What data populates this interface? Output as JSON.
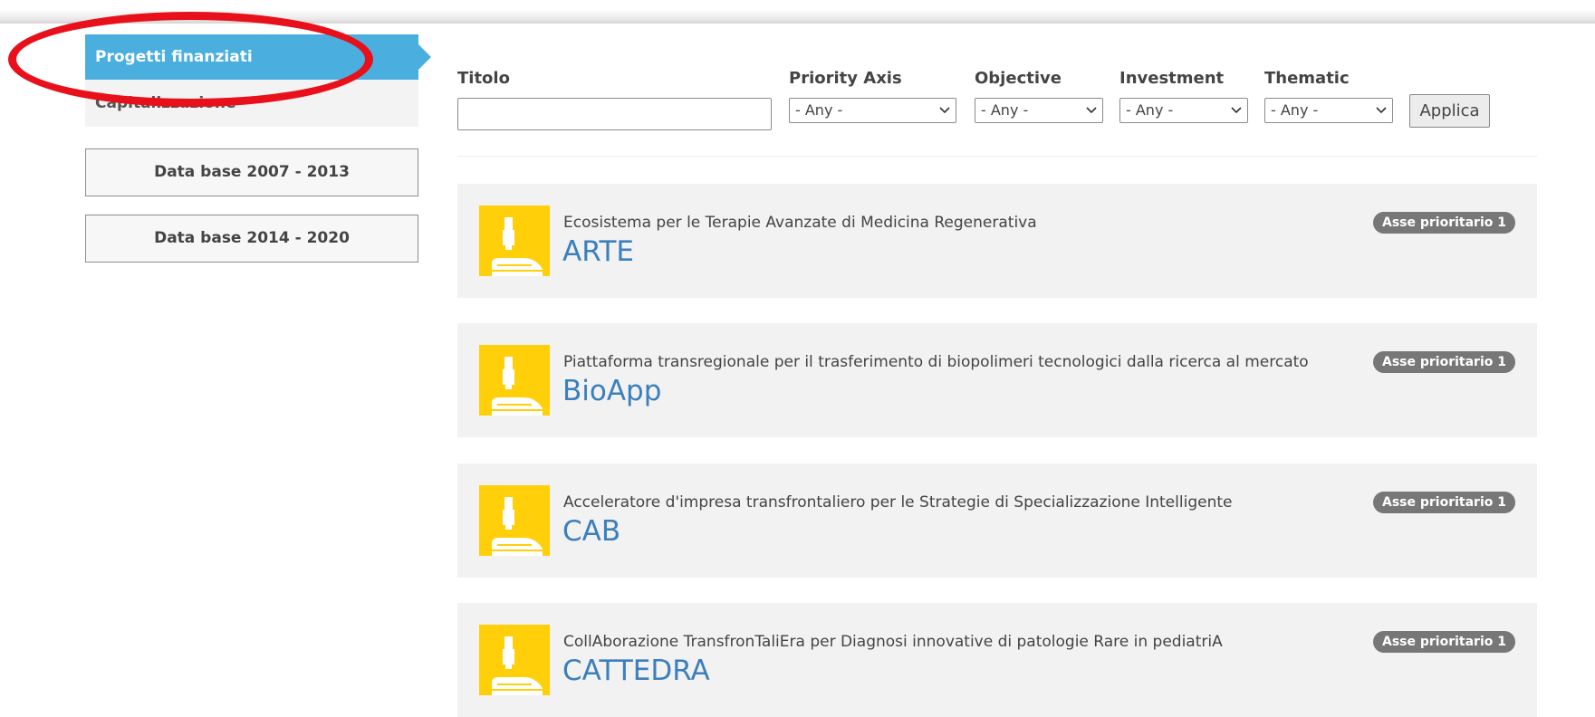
{
  "sidebar": {
    "active_item": "Progetti finanziati",
    "second_item": "Capitalizzazione",
    "db_buttons": [
      "Data base 2007 - 2013",
      "Data base 2014 - 2020"
    ]
  },
  "filters": {
    "title_label": "Titolo",
    "title_value": "",
    "selects": [
      {
        "label": "Priority Axis",
        "value": "- Any -"
      },
      {
        "label": "Objective",
        "value": "- Any -"
      },
      {
        "label": "Investment",
        "value": "- Any -"
      },
      {
        "label": "Thematic",
        "value": "- Any -"
      }
    ],
    "apply_label": "Applica"
  },
  "projects": [
    {
      "description": "Ecosistema per le Terapie Avanzate di Medicina Regenerativa",
      "name": "ARTE",
      "badge": "Asse prioritario 1"
    },
    {
      "description": "Piattaforma transregionale per il trasferimento di biopolimeri tecnologici dalla ricerca al mercato",
      "name": "BioApp",
      "badge": "Asse prioritario 1"
    },
    {
      "description": "Acceleratore d'impresa transfrontaliero per le Strategie di Specializzazione Intelligente",
      "name": "CAB",
      "badge": "Asse prioritario 1"
    },
    {
      "description": "CollAborazione TransfronTaliEra per Diagnosi innovative di patologie Rare in pediatriA",
      "name": "CATTEDRA",
      "badge": "Asse prioritario 1"
    }
  ],
  "colors": {
    "sidebar_active": "#4aafde",
    "project_icon": "#ffcf0a",
    "project_title": "#3b7fbd",
    "badge": "#777777",
    "annotation": "#e8101a"
  },
  "icons": {
    "project_icon": "microscope-icon",
    "select_arrow": "chevron-down-icon"
  }
}
